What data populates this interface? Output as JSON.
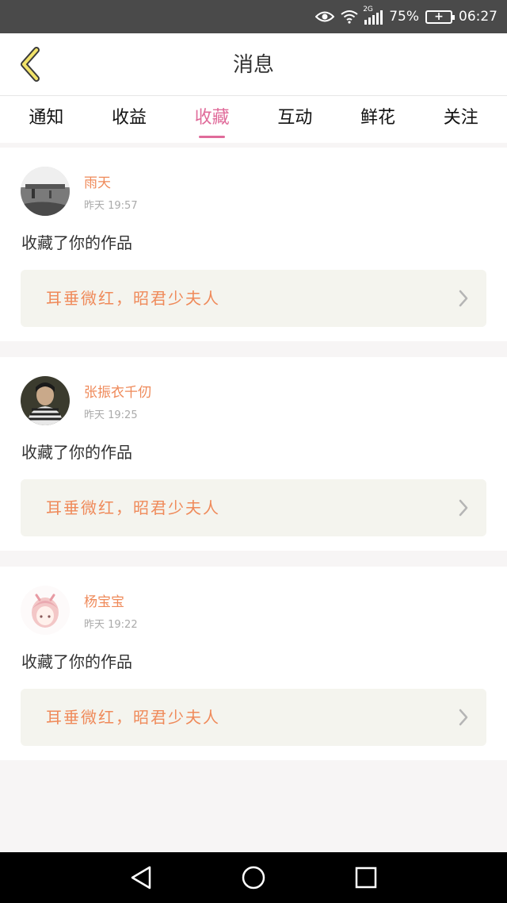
{
  "status_bar": {
    "network": "2G",
    "battery_percent": "75%",
    "time": "06:27"
  },
  "header": {
    "title": "消息"
  },
  "tabs": [
    {
      "label": "通知",
      "active": false
    },
    {
      "label": "收益",
      "active": false
    },
    {
      "label": "收藏",
      "active": true
    },
    {
      "label": "互动",
      "active": false
    },
    {
      "label": "鲜花",
      "active": false
    },
    {
      "label": "关注",
      "active": false
    }
  ],
  "messages": [
    {
      "username": "雨天",
      "time": "昨天 19:57",
      "action": "收藏了你的作品",
      "work_title": "耳垂微红，昭君少夫人"
    },
    {
      "username": "张振衣千仞",
      "time": "昨天 19:25",
      "action": "收藏了你的作品",
      "work_title": "耳垂微红，昭君少夫人"
    },
    {
      "username": "杨宝宝",
      "time": "昨天 19:22",
      "action": "收藏了你的作品",
      "work_title": "耳垂微红，昭君少夫人"
    }
  ],
  "colors": {
    "accent": "#e06b9a",
    "username": "#ef8a5a",
    "work_bg": "#f4f4ee"
  }
}
